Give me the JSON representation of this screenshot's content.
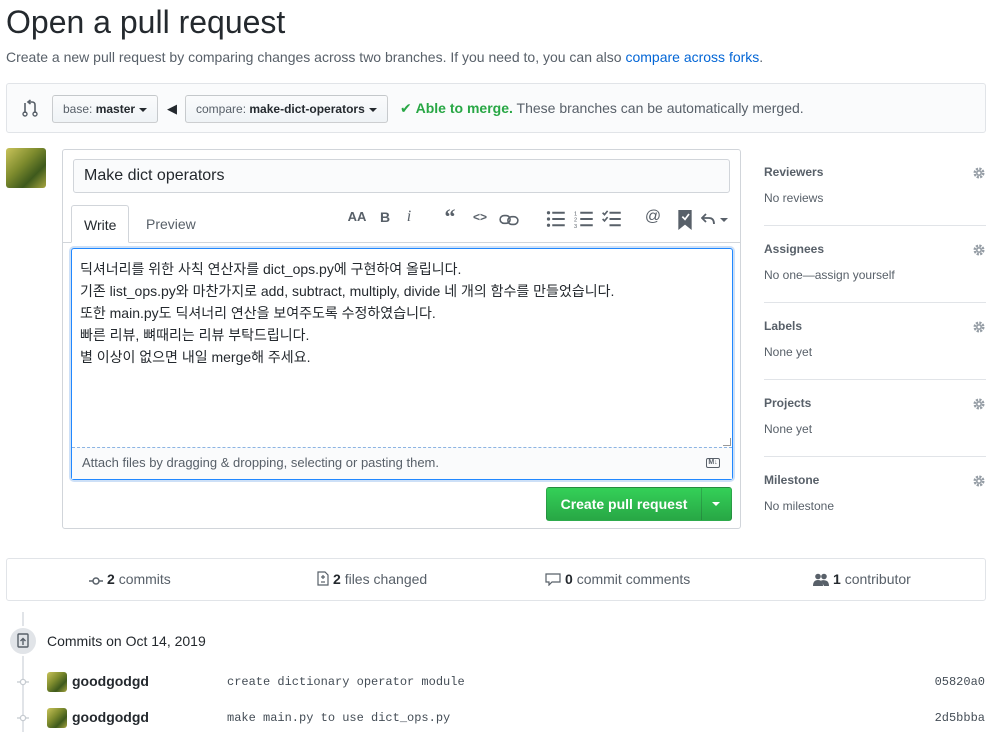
{
  "header": {
    "title": "Open a pull request",
    "subtitle": "Create a new pull request by comparing changes across two branches. If you need to, you can also ",
    "subtitle_link": "compare across forks",
    "subtitle_end": "."
  },
  "compare": {
    "base_prefix": "base:",
    "base_branch": "master",
    "compare_prefix": "compare:",
    "compare_branch": "make-dict-operators",
    "merge_ok": "Able to merge.",
    "merge_text": "These branches can be automatically merged."
  },
  "form": {
    "title_value": "Make dict operators",
    "tabs": [
      "Write",
      "Preview"
    ],
    "body_lines": [
      "딕셔너리를 위한 사칙 연산자를 dict_ops.py에 구현하여 올립니다.",
      "기존 list_ops.py와 마찬가지로 add, subtract, multiply, divide 네 개의 함수를 만들었습니다.",
      "또한 main.py도 딕셔너리 연산을 보여주도록 수정하였습니다.",
      "빠른 리뷰, 뼈때리는 리뷰 부탁드립니다.",
      "별 이상이 없으면 내일 merge해 주세요."
    ],
    "attach_text": "Attach files by dragging & dropping, selecting or pasting them.",
    "submit_label": "Create pull request",
    "toolbar_icons": [
      "header-icon",
      "bold-icon",
      "italic-icon",
      "quote-icon",
      "code-icon",
      "link-icon",
      "bulleted-list-icon",
      "numbered-list-icon",
      "task-list-icon",
      "mention-icon",
      "reference-icon",
      "reply-icon"
    ]
  },
  "sidebar": [
    {
      "heading": "Reviewers",
      "value": "No reviews"
    },
    {
      "heading": "Assignees",
      "value": "No one—assign yourself"
    },
    {
      "heading": "Labels",
      "value": "None yet"
    },
    {
      "heading": "Projects",
      "value": "None yet"
    },
    {
      "heading": "Milestone",
      "value": "No milestone"
    }
  ],
  "summary": {
    "commits_count": "2",
    "commits_label": "commits",
    "files_count": "2",
    "files_label": "files changed",
    "comments_count": "0",
    "comments_label": "commit comments",
    "contributors_count": "1",
    "contributors_label": "contributor"
  },
  "commits": {
    "heading": "Commits on Oct 14, 2019",
    "items": [
      {
        "author": "goodgodgd",
        "message": "create dictionary operator module",
        "sha": "05820a0"
      },
      {
        "author": "goodgodgd",
        "message": "make main.py to use dict_ops.py",
        "sha": "2d5bbba"
      }
    ]
  },
  "colors": {
    "accent": "#0366d6",
    "success": "#28a745",
    "border": "#e1e4e8"
  }
}
